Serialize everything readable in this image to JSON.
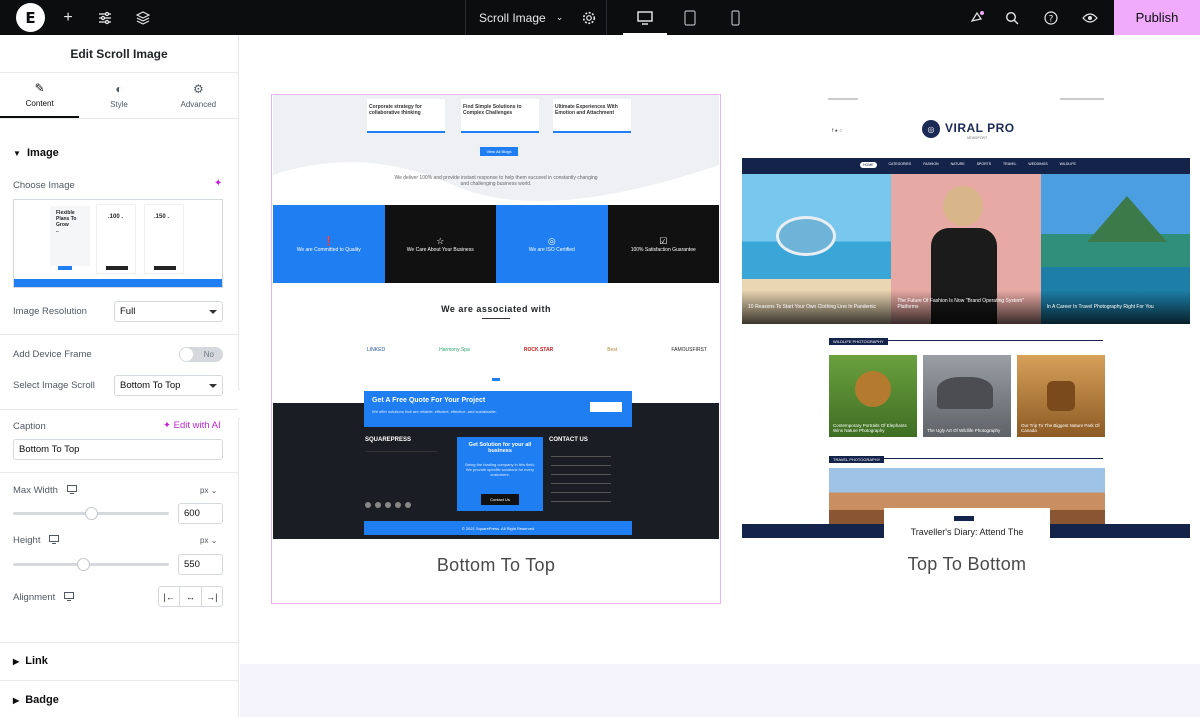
{
  "topbar": {
    "logo_letter": "E",
    "document_name": "Scroll Image",
    "publish_label": "Publish",
    "active_device": "desktop"
  },
  "panel": {
    "title": "Edit Scroll Image",
    "tabs": [
      {
        "label": "Content",
        "icon": "pencil-icon",
        "active": true
      },
      {
        "label": "Style",
        "icon": "contrast-icon",
        "active": false
      },
      {
        "label": "Advanced",
        "icon": "gear-icon",
        "active": false
      }
    ],
    "image_section": "Image",
    "choose_image_label": "Choose Image",
    "image_resolution_label": "Image Resolution",
    "image_resolution_value": "Full",
    "device_frame_label": "Add Device Frame",
    "device_frame_value": "No",
    "image_scroll_label": "Select Image Scroll",
    "image_scroll_value": "Bottom To Top",
    "caption_label": "Caption",
    "edit_ai_label": "Edit with AI",
    "caption_value": "Bottom To Top",
    "max_width_label": "Max Width",
    "max_width_unit": "px",
    "max_width_value": "600",
    "max_width_fraction": 0.5,
    "height_label": "Height",
    "height_unit": "px",
    "height_value": "550",
    "height_fraction": 0.45,
    "alignment_label": "Alignment",
    "link_section": "Link",
    "badge_section": "Badge"
  },
  "preview_left": {
    "caption": "Bottom To Top",
    "cards": [
      "Corporate strategy for collaborative thinking",
      "Find Simple Solutions to Complex Challenges",
      "Ultimate Experiences With Emotion and Attachment"
    ],
    "view_button": "View All Blogs",
    "tagline": "We deliver 100% and provide instant response to help them succeed in constantly changing and challenging business world.",
    "features": [
      "We are Committed to Quality",
      "We Care About Your Business",
      "We are ISO Certified",
      "100% Satisfaction Guarantee"
    ],
    "associated_title": "We are associated with",
    "partners": [
      "LINKED",
      "Harmony Spa",
      "ROCK STAR",
      "Best",
      "FAMOUSFIRST"
    ],
    "quote_title": "Get A Free Quote For Your Project",
    "quote_text": "We offer solutions that are reliable, efficient, effective, and sustainable.",
    "footer_brand": "SQUAREPRESS",
    "solution_title": "Get Solution for your all business",
    "solution_text": "Being the leading company in this field, We provide specific solutions for every customers.",
    "contact_button": "Contact Us",
    "contact_title": "CONTACT US",
    "copyright": "© 2021 SquarePress. All Right Reserved"
  },
  "preview_right": {
    "caption": "Top To Bottom",
    "brand": "VIRAL PRO",
    "brand_sub": "NEWSPORT",
    "nav": [
      "HOME",
      "CATEGORIES",
      "FASHION",
      "NATURE",
      "SPORTS",
      "TRAVEL",
      "WEDDINGS",
      "WILDLIFE"
    ],
    "hero_titles": [
      "10 Reasons To Start Your Own Clothing Line In Pandemic",
      "The Future Of Fashion Is Now \"Brand Operating System\" Platforms",
      "In A Career In Travel Photography Right For You"
    ],
    "wildlife_section": "WILDLIFE PHOTOGRAPHY",
    "wildlife_titles": [
      "Contemporary Portraits Of Elephants Wins Nature Photography",
      "The Ugly Art Of Wildlife Photography",
      "Our Trip To The Biggest Nature Park Of Canada"
    ],
    "travel_section": "TRAVEL PHOTOGRAPHY",
    "travel_title": "Traveller's Diary: Attend The"
  }
}
